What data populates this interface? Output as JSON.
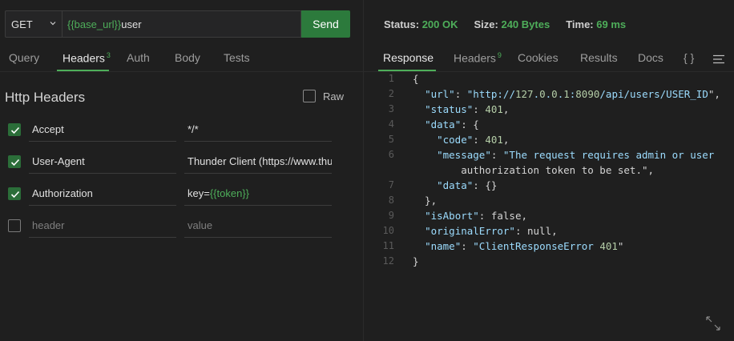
{
  "request": {
    "method": "GET",
    "url_var": "{{base_url}}",
    "url_rest": "user",
    "send_label": "Send",
    "tabs": [
      {
        "label": "Query"
      },
      {
        "label": "Headers",
        "count": "3"
      },
      {
        "label": "Auth"
      },
      {
        "label": "Body"
      },
      {
        "label": "Tests"
      }
    ],
    "section_title": "Http Headers",
    "raw_label": "Raw",
    "headers": [
      {
        "key": "Accept",
        "value": "*/*",
        "checked": true
      },
      {
        "key": "User-Agent",
        "value": "Thunder Client (https://www.thu",
        "checked": true
      },
      {
        "key": "Authorization",
        "value_prefix": "key=",
        "value_var": "{{token}}",
        "checked": true
      },
      {
        "key_placeholder": "header",
        "value_placeholder": "value",
        "checked": false
      }
    ]
  },
  "response": {
    "status_label": "Status:",
    "status_value": "200 OK",
    "size_label": "Size:",
    "size_value": "240 Bytes",
    "time_label": "Time:",
    "time_value": "69 ms",
    "tabs": [
      {
        "label": "Response"
      },
      {
        "label": "Headers",
        "count": "9"
      },
      {
        "label": "Cookies"
      },
      {
        "label": "Results"
      },
      {
        "label": "Docs"
      },
      {
        "label": "{ }"
      }
    ],
    "line_numbers": [
      "1",
      "2",
      "3",
      "4",
      "5",
      "6",
      "",
      "7",
      "8",
      "9",
      "10",
      "11",
      "12"
    ],
    "lines": [
      "{",
      "  \"url\": \"http://127.0.0.1:8090/api/users/USER_ID\",",
      "  \"status\": 401,",
      "  \"data\": {",
      "    \"code\": 401,",
      "    \"message\": \"The request requires admin or user",
      "        authorization token to be set.\",",
      "    \"data\": {}",
      "  },",
      "  \"isAbort\": false,",
      "  \"originalError\": null,",
      "  \"name\": \"ClientResponseError 401\"",
      "}"
    ]
  },
  "colors": {
    "accent": "#4eae5a",
    "send_button": "#2c7a3c",
    "background": "#1f1f1f"
  }
}
